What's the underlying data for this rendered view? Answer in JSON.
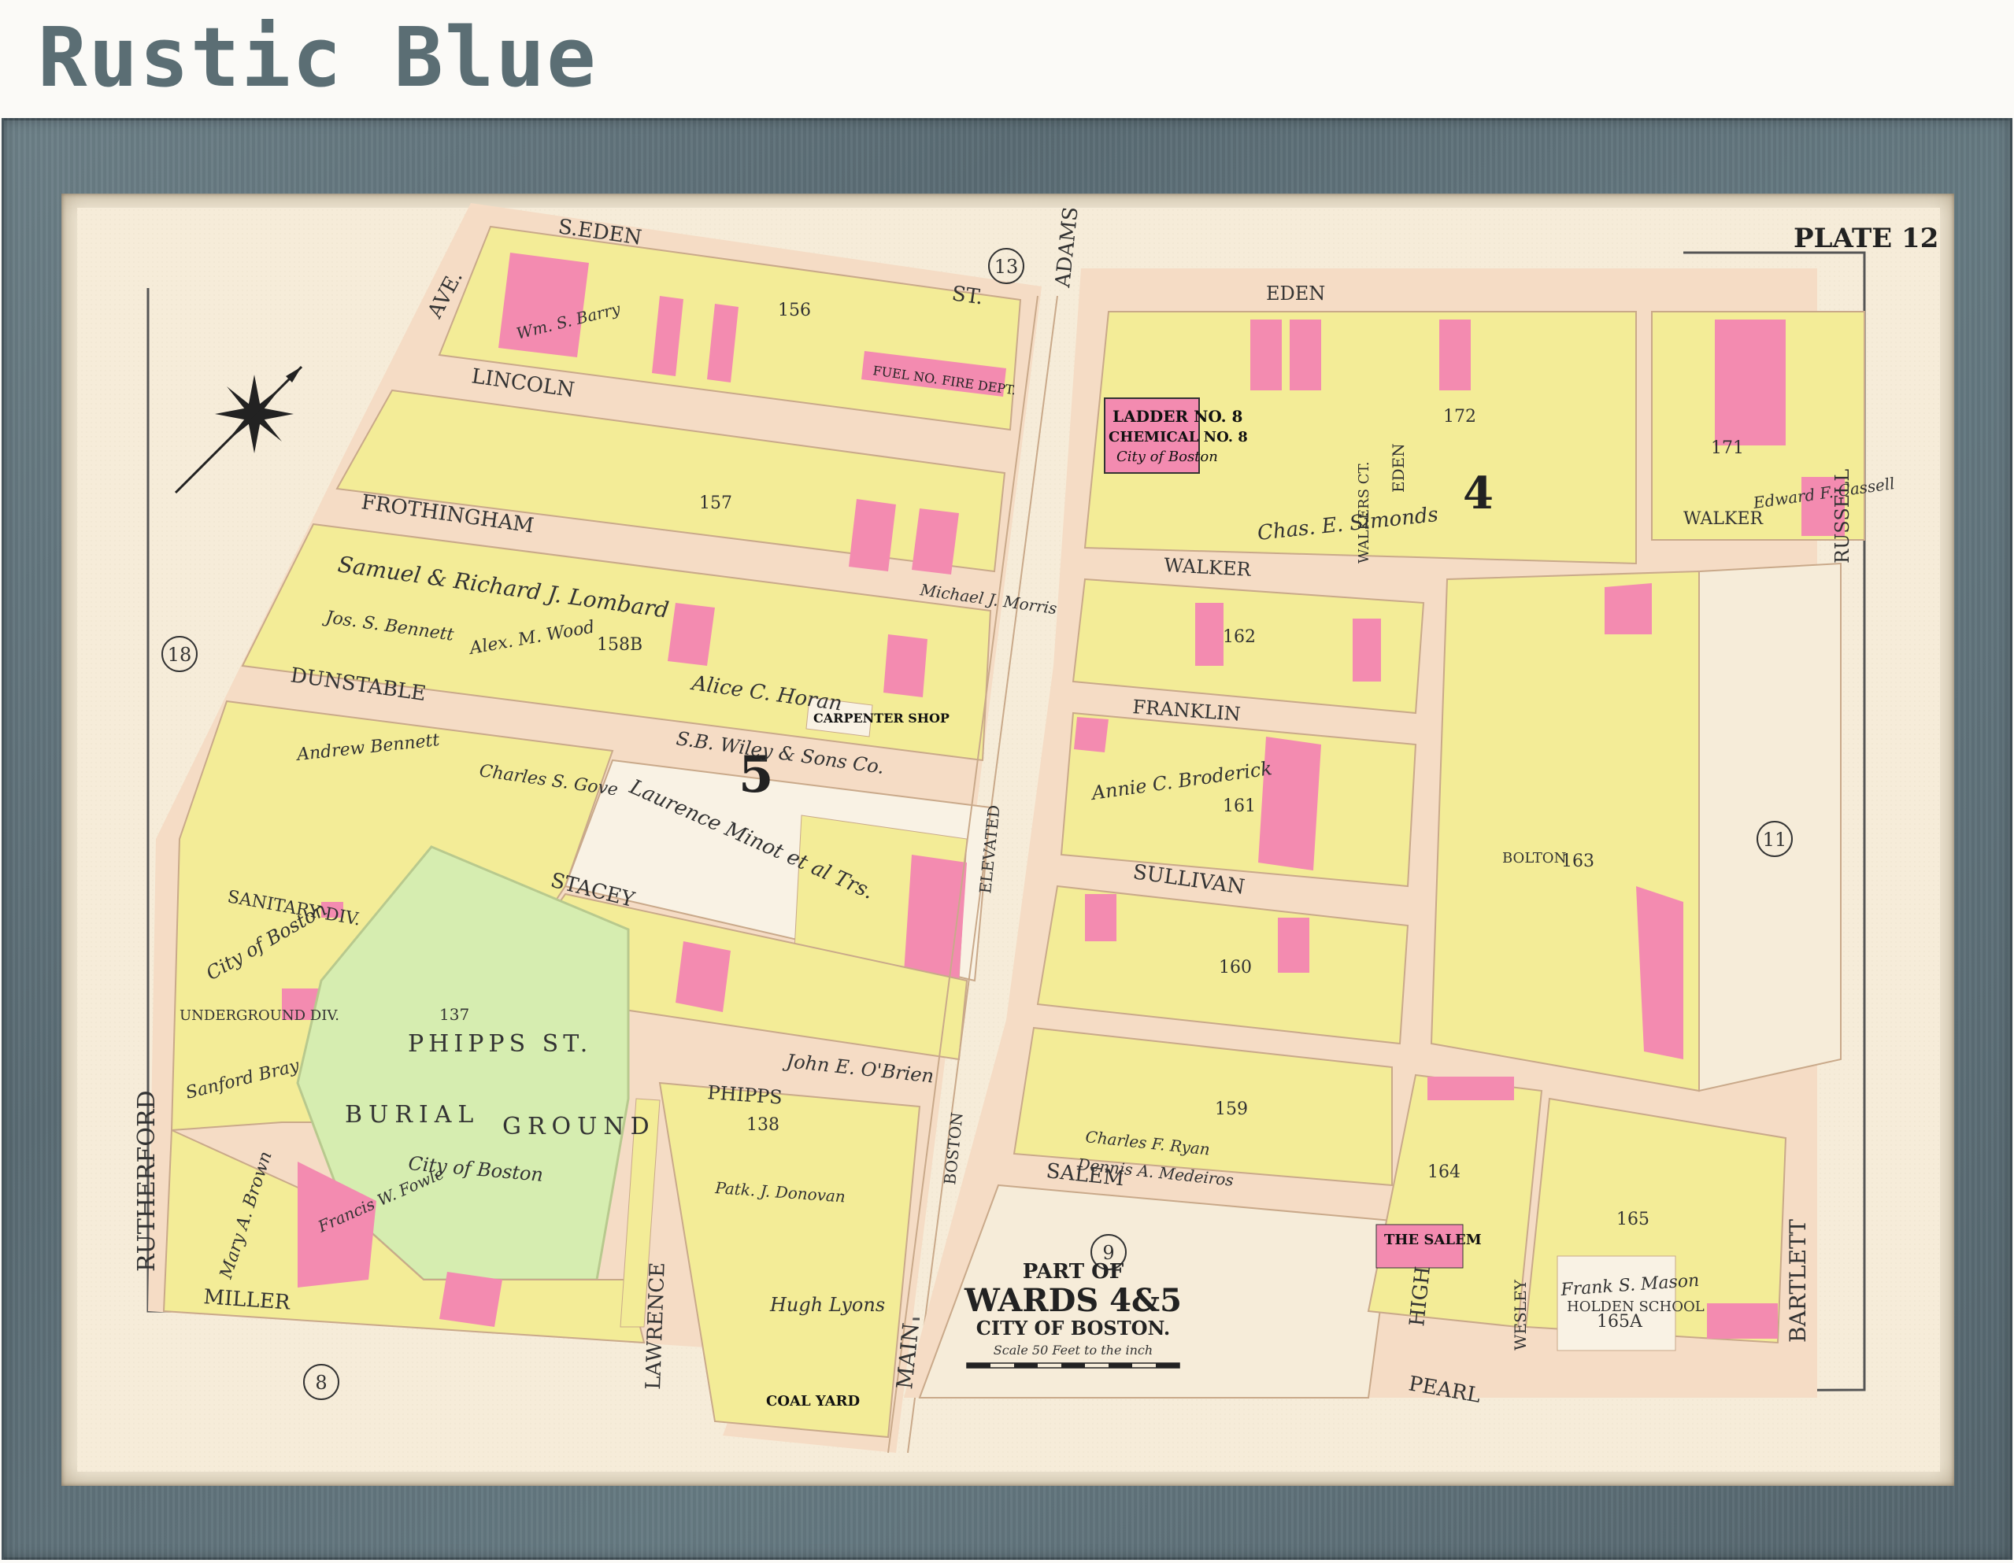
{
  "brand": {
    "title": "Rustic Blue"
  },
  "frame": {
    "color": "#5f727a",
    "mat_color": "#efe6d3"
  },
  "map": {
    "plate": "PLATE 12",
    "title_part": "PART OF",
    "title_wards": "WARDS 4&5",
    "title_city": "CITY OF BOSTON.",
    "scale_text": "Scale 50 Feet to the inch",
    "colors": {
      "paper": "#f6ecd9",
      "yellow": "#f3ec97",
      "pink": "#f38bb0",
      "green": "#d6edb0",
      "street": "#f5dcc5"
    },
    "streets": {
      "s_eden": "S.EDEN",
      "st_top": "ST.",
      "ave_top": "AVE.",
      "lincoln": "LINCOLN",
      "frothingham": "FROTHINGHAM",
      "dunstable": "DUNSTABLE",
      "stacey": "STACEY",
      "rutherford": "RUTHERFORD",
      "miller": "MILLER",
      "lawrence": "LAWRENCE",
      "phipps": "PHIPPS",
      "main": "MAIN",
      "eden": "EDEN",
      "eden_ave": "EDEN",
      "walker": "WALKER",
      "walker2": "WALKER",
      "franklin": "FRANKLIN",
      "sullivan": "SULLIVAN",
      "salem": "SALEM",
      "high": "HIGH",
      "pearl": "PEARL",
      "bolton": "BOLTON",
      "wesley": "WESLEY",
      "bartlett": "BARTLETT",
      "russell": "RUSSELL",
      "adams": "ADAMS",
      "walkers_ct": "WALKERS CT.",
      "elevated": "ELEVATED",
      "boston": "BOSTON"
    },
    "ward_numbers": [
      "13",
      "18",
      "8",
      "9",
      "11"
    ],
    "block_numbers": [
      "156",
      "157",
      "158B",
      "137",
      "138",
      "160",
      "159",
      "162",
      "161",
      "163",
      "164",
      "165",
      "165A",
      "171",
      "172"
    ],
    "ward_big_numbers": [
      "5",
      "4"
    ],
    "labels": {
      "burial1": "PHIPPS ST.",
      "burial2": "BURIAL",
      "burial3": "GROUND",
      "burial_owner": "City of Boston",
      "ladder1": "LADDER NO. 8",
      "ladder2": "CHEMICAL NO. 8",
      "ladder3": "City of Boston",
      "fire": "FUEL NO. FIRE DEPT.",
      "sanitary": "SANITARY DIV.",
      "underground": "UNDERGROUND DIV.",
      "city_of_boston": "City of Boston",
      "holden_school": "HOLDEN SCHOOL",
      "the_salem": "THE SALEM",
      "carpenter": "CARPENTER SHOP",
      "coal_yard": "COAL YARD"
    },
    "owners": {
      "lombard": "Samuel & Richard J. Lombard",
      "horan": "Alice C. Horan",
      "wiley": "S.B. Wiley & Sons Co.",
      "minot": "Laurence Minot et al Trs.",
      "bennett": "Jos. S. Bennett",
      "gove": "Charles S. Gove",
      "braintree": "Andrew Bennett",
      "brazier": "Sanford Bray",
      "brown": "Mary A. Brown",
      "fowle": "Francis W. Fowle",
      "lyons": "Hugh Lyons",
      "mason": "Frank S. Mason",
      "cassell": "Edward F. Cassell",
      "broderick": "Annie C. Broderick",
      "ryan": "Charles F. Ryan",
      "medeiros": "Dennis A. Medeiros",
      "simonds": "Chas. E. Simonds",
      "obrien": "John E. O'Brien",
      "barry": "Wm. S. Barry",
      "wood": "Alex. M. Wood",
      "morris": "Michael J. Morris",
      "donovan": "Patk. J. Donovan"
    }
  }
}
